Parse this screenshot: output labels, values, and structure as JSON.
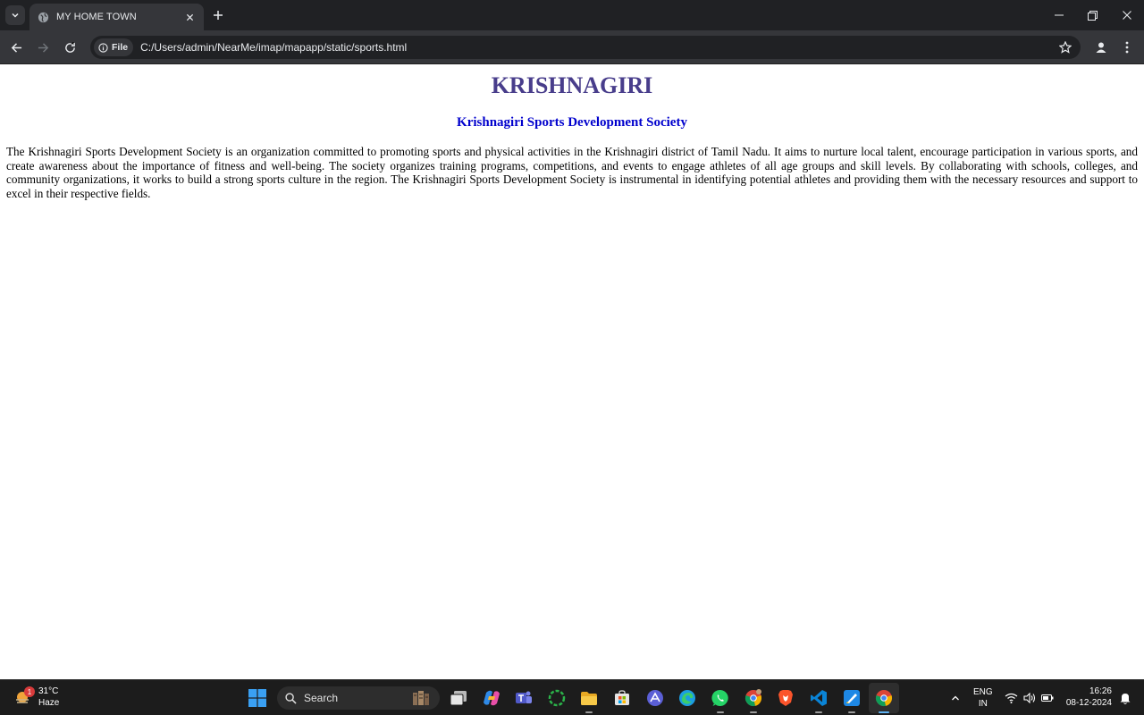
{
  "browser": {
    "tab_title": "MY HOME TOWN",
    "address_chip": "File",
    "url": "C:/Users/admin/NearMe/imap/mapapp/static/sports.html"
  },
  "page": {
    "heading": "KRISHNAGIRI",
    "subheading": "Krishnagiri Sports Development Society",
    "paragraph": "The Krishnagiri Sports Development Society is an organization committed to promoting sports and physical activities in the Krishnagiri district of Tamil Nadu. It aims to nurture local talent, encourage participation in various sports, and create awareness about the importance of fitness and well-being. The society organizes training programs, competitions, and events to engage athletes of all age groups and skill levels. By collaborating with schools, colleges, and community organizations, it works to build a strong sports culture in the region. The Krishnagiri Sports Development Society is instrumental in identifying potential athletes and providing them with the necessary resources and support to excel in their respective fields."
  },
  "taskbar": {
    "weather_badge": "1",
    "temperature": "31°C",
    "condition": "Haze",
    "search_label": "Search",
    "language": "ENG",
    "region": "IN",
    "time": "16:26",
    "date": "08-12-2024",
    "apps": [
      "start-icon",
      "task-view-icon",
      "copilot-icon",
      "teams-icon",
      "refresh-app-icon",
      "file-explorer-icon",
      "microsoft-store-icon",
      "arc-icon",
      "edge-icon",
      "whatsapp-icon",
      "chrome-profile-icon",
      "brave-icon",
      "vscode-icon",
      "paint-icon",
      "chrome-icon"
    ]
  },
  "colors": {
    "heading": "#483d8b",
    "subheading": "#0000cd",
    "chrome_dark": "#202124",
    "chrome_toolbar": "#35363a",
    "taskbar": "#1c1c1c"
  }
}
